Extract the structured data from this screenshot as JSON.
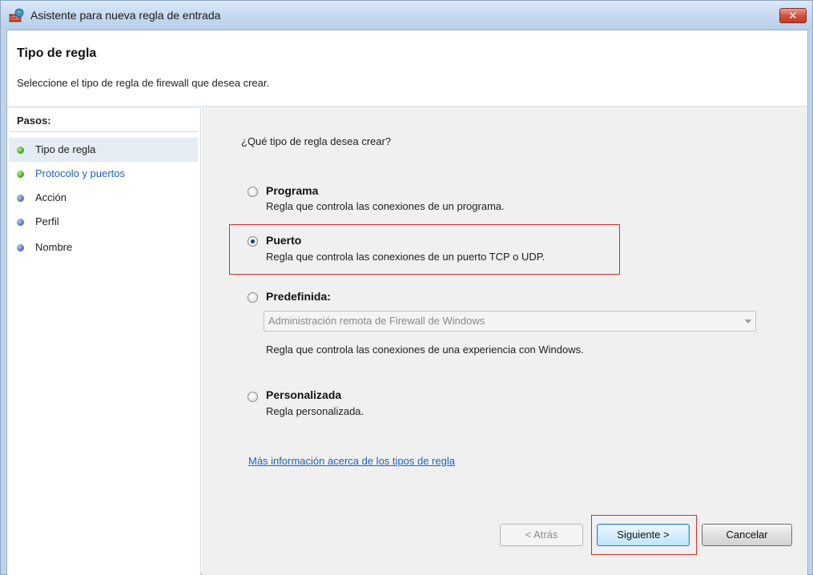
{
  "window": {
    "title": "Asistente para nueva regla de entrada",
    "close_glyph": "✕"
  },
  "header": {
    "title": "Tipo de regla",
    "description": "Seleccione el tipo de regla de firewall que desea crear."
  },
  "steps": {
    "title": "Pasos:",
    "items": [
      {
        "label": "Tipo de regla",
        "icon": "green-dot-icon",
        "active": true
      },
      {
        "label": "Protocolo y puertos",
        "icon": "green-dot-icon",
        "link": true
      },
      {
        "label": "Acción",
        "icon": "blue-dot-icon"
      },
      {
        "label": "Perfil",
        "icon": "blue-dot-icon"
      },
      {
        "label": "Nombre",
        "icon": "blue-dot-icon"
      }
    ]
  },
  "content": {
    "question": "¿Qué tipo de regla desea crear?",
    "options": [
      {
        "label": "Programa",
        "description": "Regla que controla las conexiones de un programa.",
        "selected": false
      },
      {
        "label": "Puerto",
        "description": "Regla que controla las conexiones de un puerto TCP o UDP.",
        "selected": true
      },
      {
        "label": "Predefinida:",
        "description": "Regla que controla las conexiones de una experiencia con Windows.",
        "selected": false
      },
      {
        "label": "Personalizada",
        "description": "Regla personalizada.",
        "selected": false
      }
    ],
    "predefined_select_value": "Administración remota de Firewall de Windows",
    "more_info_link": "Más información acerca de los tipos de regla"
  },
  "buttons": {
    "back": "< Atrás",
    "next": "Siguiente >",
    "cancel": "Cancelar"
  },
  "colors": {
    "highlight": "#d92b2b",
    "link": "#1b62c2",
    "titlebar": "#c4d8ef"
  }
}
